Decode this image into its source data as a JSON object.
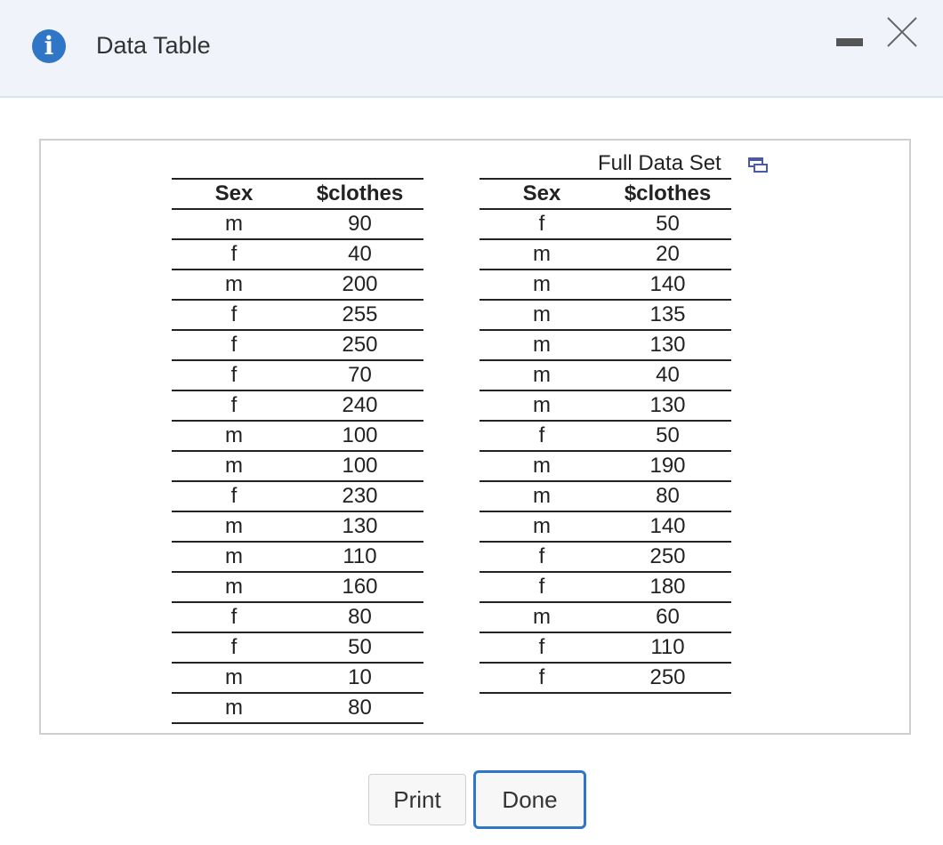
{
  "dialog": {
    "title": "Data Table",
    "full_data_label": "Full Data Set",
    "accent_color": "#2f76c6"
  },
  "icons": {
    "info": "info-icon",
    "minimize": "minimize-icon",
    "close": "close-icon",
    "popout": "popout-icon"
  },
  "table_left": {
    "headers": [
      "Sex",
      "$clothes"
    ],
    "rows": [
      [
        "m",
        "90"
      ],
      [
        "f",
        "40"
      ],
      [
        "m",
        "200"
      ],
      [
        "f",
        "255"
      ],
      [
        "f",
        "250"
      ],
      [
        "f",
        "70"
      ],
      [
        "f",
        "240"
      ],
      [
        "m",
        "100"
      ],
      [
        "m",
        "100"
      ],
      [
        "f",
        "230"
      ],
      [
        "m",
        "130"
      ],
      [
        "m",
        "110"
      ],
      [
        "m",
        "160"
      ],
      [
        "f",
        "80"
      ],
      [
        "f",
        "50"
      ],
      [
        "m",
        "10"
      ],
      [
        "m",
        "80"
      ]
    ]
  },
  "table_right": {
    "headers": [
      "Sex",
      "$clothes"
    ],
    "rows": [
      [
        "f",
        "50"
      ],
      [
        "m",
        "20"
      ],
      [
        "m",
        "140"
      ],
      [
        "m",
        "135"
      ],
      [
        "m",
        "130"
      ],
      [
        "m",
        "40"
      ],
      [
        "m",
        "130"
      ],
      [
        "f",
        "50"
      ],
      [
        "m",
        "190"
      ],
      [
        "m",
        "80"
      ],
      [
        "m",
        "140"
      ],
      [
        "f",
        "250"
      ],
      [
        "f",
        "180"
      ],
      [
        "m",
        "60"
      ],
      [
        "f",
        "110"
      ],
      [
        "f",
        "250"
      ]
    ]
  },
  "buttons": {
    "print": "Print",
    "done": "Done"
  }
}
